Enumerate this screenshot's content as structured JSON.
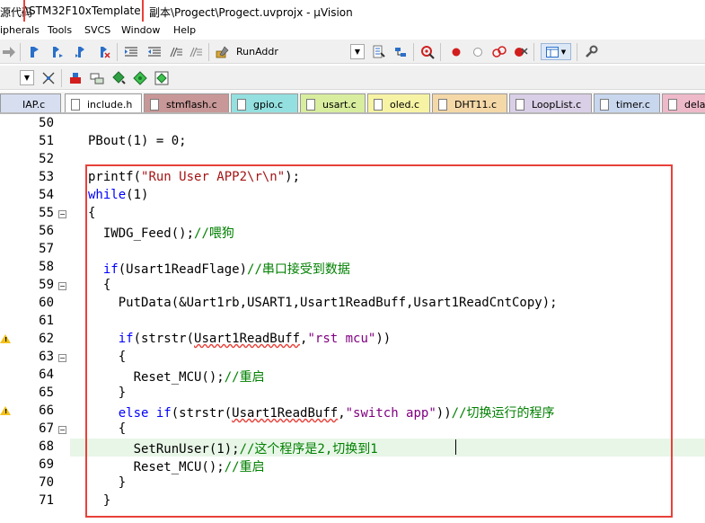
{
  "window": {
    "title_prefix": "源代码",
    "title_project": "\\STM32F10xTemplate",
    "title_rest": "副本\\Progect\\Progect.uvprojx - µVision"
  },
  "menu": [
    "ipherals",
    "Tools",
    "SVCS",
    "Window",
    "Help"
  ],
  "toolbar": {
    "target_label": "RunAddr"
  },
  "tabs": [
    {
      "label": "IAP.c",
      "color": "#d6def0"
    },
    {
      "label": "include.h",
      "color": "#ffffff"
    },
    {
      "label": "stmflash.c",
      "color": "#c89797"
    },
    {
      "label": "gpio.c",
      "color": "#94e0e0"
    },
    {
      "label": "usart.c",
      "color": "#d8ed9e"
    },
    {
      "label": "oled.c",
      "color": "#f7f3a4"
    },
    {
      "label": "DHT11.c",
      "color": "#f4d8a8"
    },
    {
      "label": "LoopList.c",
      "color": "#d9cfe6"
    },
    {
      "label": "timer.c",
      "color": "#c8d7ee"
    },
    {
      "label": "dela",
      "color": "#eeb9c9"
    }
  ],
  "editor": {
    "line_numbers": [
      "50",
      "51",
      "52",
      "53",
      "54",
      "55",
      "56",
      "57",
      "58",
      "59",
      "60",
      "61",
      "62",
      "63",
      "64",
      "65",
      "66",
      "67",
      "68",
      "69",
      "70",
      "71"
    ],
    "warning_lines": [
      "62",
      "66"
    ],
    "fold_lines": [
      "55",
      "59",
      "63",
      "67"
    ],
    "current_line": "68",
    "lines": [
      {
        "segments": []
      },
      {
        "segments": [
          {
            "t": "PBout(1) = 0;",
            "c": ""
          }
        ]
      },
      {
        "segments": []
      },
      {
        "segments": [
          {
            "t": "printf(",
            "c": ""
          },
          {
            "t": "\"Run User APP2\\r\\n\"",
            "c": "str"
          },
          {
            "t": ");",
            "c": ""
          }
        ]
      },
      {
        "segments": [
          {
            "t": "while",
            "c": "kw"
          },
          {
            "t": "(1)",
            "c": ""
          }
        ]
      },
      {
        "segments": [
          {
            "t": "{",
            "c": ""
          }
        ]
      },
      {
        "segments": [
          {
            "t": "  IWDG_Feed();",
            "c": ""
          },
          {
            "t": "//喂狗",
            "c": "cmt"
          }
        ]
      },
      {
        "segments": []
      },
      {
        "segments": [
          {
            "t": "  ",
            "c": ""
          },
          {
            "t": "if",
            "c": "kw"
          },
          {
            "t": "(Usart1ReadFlage)",
            "c": ""
          },
          {
            "t": "//串口接受到数据",
            "c": "cmt"
          }
        ]
      },
      {
        "segments": [
          {
            "t": "  {",
            "c": ""
          }
        ]
      },
      {
        "segments": [
          {
            "t": "    PutData(&Uart1rb,USART1,Usart1ReadBuff,Usart1ReadCntCopy);",
            "c": ""
          }
        ]
      },
      {
        "segments": []
      },
      {
        "segments": [
          {
            "t": "    ",
            "c": ""
          },
          {
            "t": "if",
            "c": "kw"
          },
          {
            "t": "(strstr(",
            "c": ""
          },
          {
            "t": "Usart1ReadBuff",
            "c": "sq"
          },
          {
            "t": ",",
            "c": ""
          },
          {
            "t": "\"rst mcu\"",
            "c": "pur"
          },
          {
            "t": "))",
            "c": ""
          }
        ]
      },
      {
        "segments": [
          {
            "t": "    {",
            "c": ""
          }
        ]
      },
      {
        "segments": [
          {
            "t": "      Reset_MCU();",
            "c": ""
          },
          {
            "t": "//重启",
            "c": "cmt"
          }
        ]
      },
      {
        "segments": [
          {
            "t": "    }",
            "c": ""
          }
        ]
      },
      {
        "segments": [
          {
            "t": "    ",
            "c": ""
          },
          {
            "t": "else if",
            "c": "kw"
          },
          {
            "t": "(strstr(",
            "c": ""
          },
          {
            "t": "Usart1ReadBuff",
            "c": "sq"
          },
          {
            "t": ",",
            "c": ""
          },
          {
            "t": "\"switch app\"",
            "c": "pur"
          },
          {
            "t": "))",
            "c": ""
          },
          {
            "t": "//切换运行的程序",
            "c": "cmt"
          }
        ]
      },
      {
        "segments": [
          {
            "t": "    {",
            "c": ""
          }
        ]
      },
      {
        "segments": [
          {
            "t": "      SetRunUser(1);",
            "c": ""
          },
          {
            "t": "//这个程序是2,切换到1",
            "c": "cmt"
          }
        ]
      },
      {
        "segments": [
          {
            "t": "      Reset_MCU();",
            "c": ""
          },
          {
            "t": "//重启",
            "c": "cmt"
          }
        ]
      },
      {
        "segments": [
          {
            "t": "    }",
            "c": ""
          }
        ]
      },
      {
        "segments": [
          {
            "t": "  }",
            "c": ""
          }
        ]
      }
    ]
  }
}
